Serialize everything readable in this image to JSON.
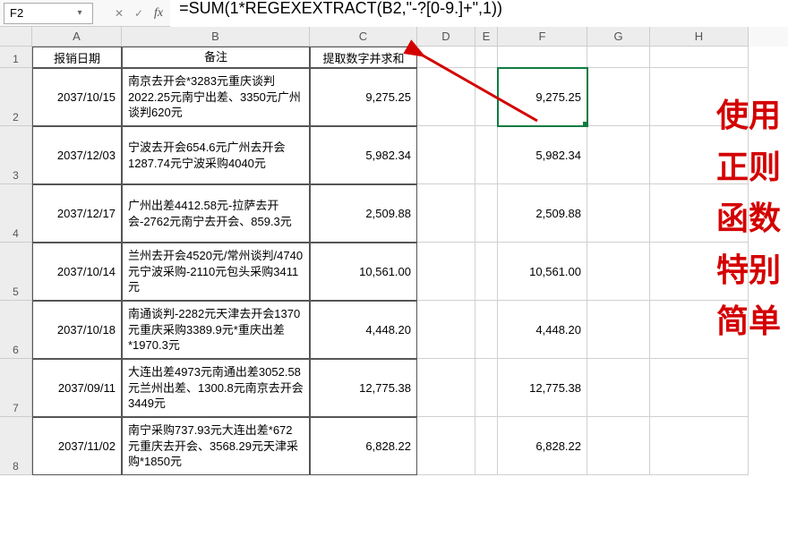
{
  "namebox": {
    "ref": "F2"
  },
  "formula_bar": {
    "text": "=SUM(1*REGEXEXTRACT(B2,\"-?[0-9.]+\",1))"
  },
  "fx": {
    "cancel": "✕",
    "confirm": "✓",
    "label": "fx"
  },
  "columns": [
    "A",
    "B",
    "C",
    "D",
    "E",
    "F",
    "G",
    "H"
  ],
  "headers": {
    "A": "报销日期",
    "B": "备注",
    "C": "提取数字并求和"
  },
  "rows": [
    {
      "n": "2",
      "date": "2037/10/15",
      "note": "南京去开会*3283元重庆谈判2022.25元南宁出差、3350元广州谈判620元",
      "c": "9,275.25",
      "f": "9,275.25"
    },
    {
      "n": "3",
      "date": "2037/12/03",
      "note": "宁波去开会654.6元广州去开会1287.74元宁波采购4040元",
      "c": "5,982.34",
      "f": "5,982.34"
    },
    {
      "n": "4",
      "date": "2037/12/17",
      "note": "广州出差4412.58元-拉萨去开会-2762元南宁去开会、859.3元",
      "c": "2,509.88",
      "f": "2,509.88"
    },
    {
      "n": "5",
      "date": "2037/10/14",
      "note": "兰州去开会4520元/常州谈判/4740元宁波采购-2110元包头采购3411元",
      "c": "10,561.00",
      "f": "10,561.00"
    },
    {
      "n": "6",
      "date": "2037/10/18",
      "note": "南通谈判-2282元天津去开会1370元重庆采购3389.9元*重庆出差*1970.3元",
      "c": "4,448.20",
      "f": "4,448.20"
    },
    {
      "n": "7",
      "date": "2037/09/11",
      "note": "大连出差4973元南通出差3052.58元兰州出差、1300.8元南京去开会3449元",
      "c": "12,775.38",
      "f": "12,775.38"
    },
    {
      "n": "8",
      "date": "2037/11/02",
      "note": "南宁采购737.93元大连出差*672元重庆去开会、3568.29元天津采购*1850元",
      "c": "6,828.22",
      "f": "6,828.22"
    }
  ],
  "overlay": {
    "l1": "使用",
    "l2": "正则",
    "l3": "函数",
    "l4": "特别",
    "l5": "简单"
  },
  "selected_cell": "F2"
}
